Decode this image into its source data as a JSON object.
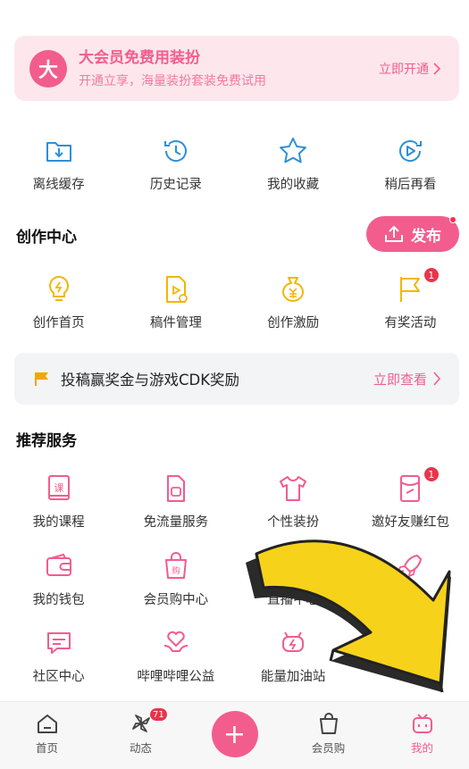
{
  "vip": {
    "badge": "大",
    "title": "大会员免费用装扮",
    "subtitle": "开通立享，海量装扮套装免费试用",
    "cta": "立即开通"
  },
  "quick_actions": [
    {
      "label": "离线缓存",
      "icon": "download-folder-icon"
    },
    {
      "label": "历史记录",
      "icon": "history-clock-icon"
    },
    {
      "label": "我的收藏",
      "icon": "star-icon"
    },
    {
      "label": "稍后再看",
      "icon": "watch-later-icon"
    }
  ],
  "creation": {
    "title": "创作中心",
    "publish_label": "发布",
    "items": [
      {
        "label": "创作首页",
        "icon": "lightbulb-icon"
      },
      {
        "label": "稿件管理",
        "icon": "manuscript-icon"
      },
      {
        "label": "创作激励",
        "icon": "money-bag-icon"
      },
      {
        "label": "有奖活动",
        "icon": "flag-icon",
        "badge": "1"
      }
    ]
  },
  "promo": {
    "text": "投稿赢奖金与游戏CDK奖励",
    "cta": "立即查看"
  },
  "services": {
    "title": "推荐服务",
    "rows": [
      [
        {
          "label": "我的课程",
          "icon": "course-book-icon"
        },
        {
          "label": "免流量服务",
          "icon": "sim-card-icon"
        },
        {
          "label": "个性装扮",
          "icon": "tshirt-icon"
        },
        {
          "label": "邀好友赚红包",
          "icon": "red-packet-icon",
          "badge": "1"
        }
      ],
      [
        {
          "label": "我的钱包",
          "icon": "wallet-icon"
        },
        {
          "label": "会员购中心",
          "icon": "shopping-bag-icon"
        },
        {
          "label": "直播中心",
          "icon": "live-tv-icon"
        },
        {
          "label": "",
          "icon": "rocket-icon"
        }
      ],
      [
        {
          "label": "社区中心",
          "icon": "chat-bubble-icon"
        },
        {
          "label": "哔哩哔哩公益",
          "icon": "heart-hands-icon"
        },
        {
          "label": "能量加油站",
          "icon": "energy-station-icon"
        },
        {
          "label": "",
          "icon": ""
        }
      ]
    ]
  },
  "tabbar": {
    "items": [
      {
        "label": "首页",
        "icon": "home-icon"
      },
      {
        "label": "动态",
        "icon": "pinwheel-icon",
        "badge": "71"
      },
      {
        "label": "",
        "icon": "plus-icon"
      },
      {
        "label": "会员购",
        "icon": "shopping-bag-icon"
      },
      {
        "label": "我的",
        "icon": "tv-mascot-icon"
      }
    ],
    "active": "我的"
  },
  "colors": {
    "accent": "#f25d8e",
    "accent_light": "#fde7ec",
    "icon_blue": "#2f8fd6",
    "icon_yellow": "#f2b705",
    "arrow_yellow": "#f7d21b"
  }
}
